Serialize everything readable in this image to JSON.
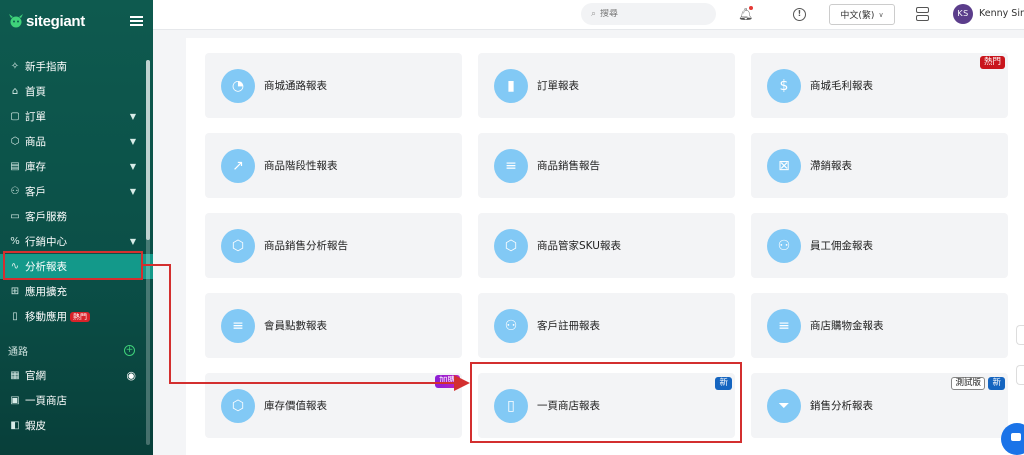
{
  "brand": {
    "logo_text": "sitegiant"
  },
  "sidebar": {
    "items": [
      {
        "label": "新手指南",
        "icon": "✧"
      },
      {
        "label": "首頁",
        "icon": "⌂"
      },
      {
        "label": "訂單",
        "icon": "▢",
        "has_children": true
      },
      {
        "label": "商品",
        "icon": "⬡",
        "has_children": true
      },
      {
        "label": "庫存",
        "icon": "▤",
        "has_children": true
      },
      {
        "label": "客戶",
        "icon": "⚇",
        "has_children": true
      },
      {
        "label": "客戶服務",
        "icon": "▭"
      },
      {
        "label": "行銷中心",
        "icon": "%",
        "has_children": true
      },
      {
        "label": "分析報表",
        "icon": "∿",
        "active": true
      },
      {
        "label": "應用擴充",
        "icon": "⊞"
      },
      {
        "label": "移動應用",
        "icon": "▯",
        "badge": "熱門"
      }
    ],
    "section_label": "通路",
    "channels": [
      {
        "label": "官網",
        "icon": "▦"
      },
      {
        "label": "一頁商店",
        "icon": "▣"
      },
      {
        "label": "蝦皮",
        "icon": "◧"
      }
    ]
  },
  "topbar": {
    "search_placeholder": "搜尋",
    "language": "中文(繁)",
    "avatar_initials": "KS",
    "username": "Kenny Sim"
  },
  "reports": [
    {
      "label": "商城通路報表",
      "icon": "◔"
    },
    {
      "label": "訂單報表",
      "icon": "▮"
    },
    {
      "label": "商城毛利報表",
      "icon": "$",
      "badge_hot": "熱門"
    },
    {
      "label": "商品階段性報表",
      "icon": "↗"
    },
    {
      "label": "商品銷售報告",
      "icon": "≡"
    },
    {
      "label": "滯銷報表",
      "icon": "⊠"
    },
    {
      "label": "商品銷售分析報告",
      "icon": "⬡"
    },
    {
      "label": "商品管家SKU報表",
      "icon": "⬡"
    },
    {
      "label": "員工佣金報表",
      "icon": "⚇"
    },
    {
      "label": "會員點數報表",
      "icon": "≡"
    },
    {
      "label": "客戶註冊報表",
      "icon": "⚇"
    },
    {
      "label": "商店購物金報表",
      "icon": "≡"
    },
    {
      "label": "庫存價值報表",
      "icon": "⬡",
      "badge_addon": "加購"
    },
    {
      "label": "一頁商店報表",
      "icon": "▯",
      "badge_new": "新"
    },
    {
      "label": "銷售分析報表",
      "icon": "⏷",
      "badge_beta": "測試版",
      "badge_new": "新"
    }
  ],
  "colors": {
    "sidebar_bg": "#0e5a4f",
    "active_item": "#13998a",
    "icon_circle": "#82c9f5",
    "highlight": "#d32f2f",
    "badge_hot": "#c9161d",
    "badge_new": "#1565c0"
  }
}
